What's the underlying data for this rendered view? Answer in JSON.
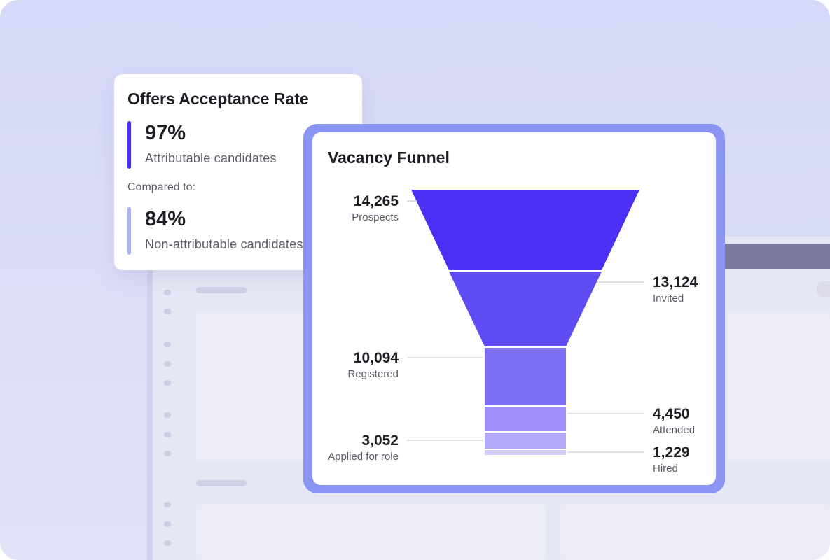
{
  "offers_card": {
    "title": "Offers Acceptance Rate",
    "primary": {
      "value": "97%",
      "label": "Attributable candidates",
      "color": "#4a33ee"
    },
    "compared_label": "Compared to:",
    "secondary": {
      "value": "84%",
      "label": "Non-attributable candidates",
      "color": "#aab4f5"
    }
  },
  "funnel_card": {
    "title": "Vacancy Funnel",
    "frame_color": "#8b95f3"
  },
  "chart_data": {
    "type": "funnel",
    "title": "Vacancy Funnel",
    "stages": [
      {
        "label": "Prospects",
        "value": 14265,
        "display": "14,265",
        "color": "#4b2ff5",
        "side": "left"
      },
      {
        "label": "Invited",
        "value": 13124,
        "display": "13,124",
        "color": "#5f4cf3",
        "side": "right"
      },
      {
        "label": "Registered",
        "value": 10094,
        "display": "10,094",
        "color": "#7d6ff4",
        "side": "left"
      },
      {
        "label": "Attended",
        "value": 4450,
        "display": "4,450",
        "color": "#9d8ff7",
        "side": "right"
      },
      {
        "label": "Applied for role",
        "value": 3052,
        "display": "3,052",
        "color": "#b3a9f9",
        "side": "left"
      },
      {
        "label": "Hired",
        "value": 1229,
        "display": "1,229",
        "color": "#d2cbfb",
        "side": "right"
      }
    ]
  }
}
